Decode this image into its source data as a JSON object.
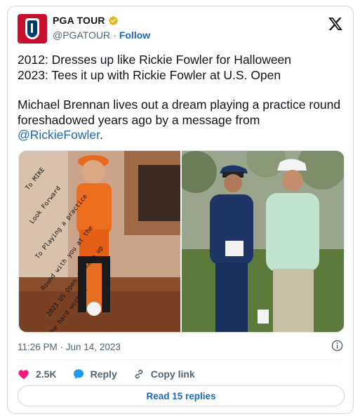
{
  "account": {
    "name": "PGA TOUR",
    "handle": "@PGATOUR",
    "separator": "·",
    "follow_label": "Follow"
  },
  "tweet": {
    "lines": [
      "2012: Dresses up like Rickie Fowler for Halloween",
      "2023: Tees it up with Rickie Fowler at U.S. Open"
    ],
    "paragraph_prefix": "Michael Brennan lives out a dream playing a practice round foreshadowed years ago by a message from ",
    "mention": "@RickieFowler",
    "paragraph_suffix": ".",
    "timestamp": "11:26 PM · Jun 14, 2023"
  },
  "media": {
    "left_photo_signature_lines": [
      "To MIKE",
      "Look Forward",
      "To Playing a practice",
      "Round with you at the",
      "2023 US Open !!  Keep up",
      "The hard work !!"
    ]
  },
  "actions": {
    "like_count": "2.5K",
    "reply_label": "Reply",
    "copy_link_label": "Copy link"
  },
  "replies_button": {
    "label": "Read 15 replies"
  },
  "colors": {
    "accent": "#1d68b5",
    "brand_red": "#c8102e",
    "brand_blue": "#003a70",
    "like_pink": "#f91880",
    "verified_gold": "#e2b719",
    "muted_text": "#536471"
  },
  "icons": {
    "verified": "verified-badge-icon",
    "logo": "x-logo-icon",
    "info": "info-icon",
    "like": "heart-icon",
    "reply": "speech-bubble-icon",
    "copy": "link-icon"
  }
}
